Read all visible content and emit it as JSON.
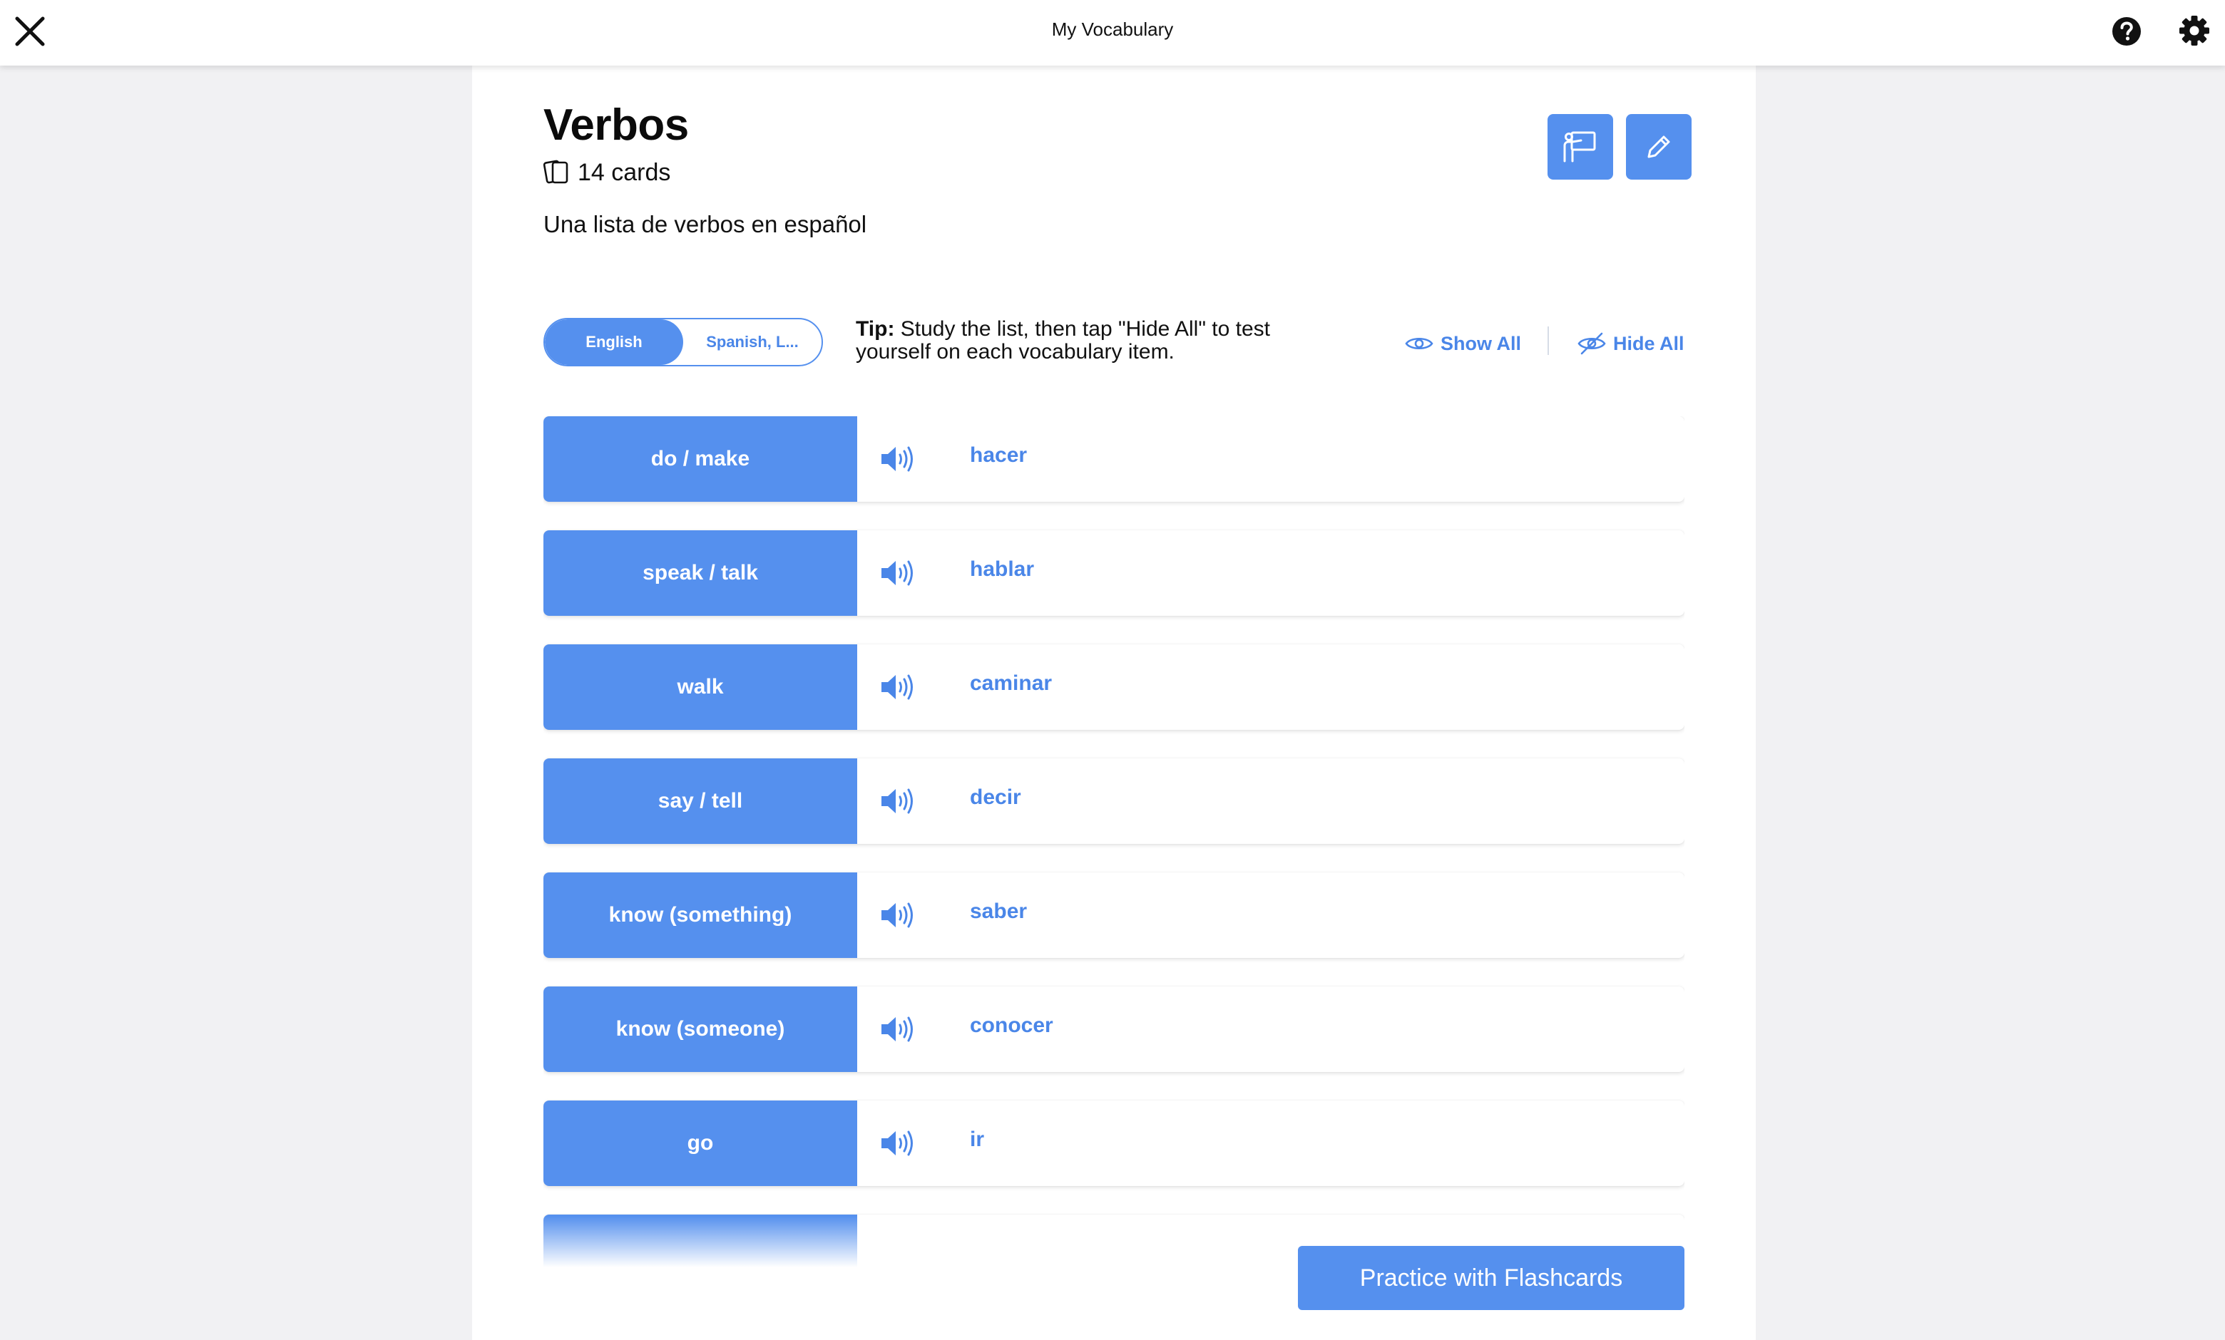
{
  "header": {
    "title": "My Vocabulary",
    "close_icon": "close-icon",
    "help_icon": "question-circle-icon",
    "settings_icon": "gear-icon"
  },
  "deck": {
    "title": "Verbos",
    "card_count": "14 cards",
    "description": "Una lista de verbos en español"
  },
  "language_toggle": {
    "options": [
      "English",
      "Spanish, L..."
    ],
    "selected": "English"
  },
  "tip": {
    "label": "Tip:",
    "text": " Study the list, then tap \"Hide All\" to test yourself on each vocabulary item."
  },
  "actions": {
    "show_all": "Show All",
    "hide_all": "Hide All",
    "practice": "Practice with Flashcards"
  },
  "vocab": [
    {
      "english": "do / make",
      "spanish": "hacer"
    },
    {
      "english": "speak / talk",
      "spanish": "hablar"
    },
    {
      "english": "walk",
      "spanish": "caminar"
    },
    {
      "english": "say / tell",
      "spanish": "decir"
    },
    {
      "english": "know (something)",
      "spanish": "saber"
    },
    {
      "english": "know (someone)",
      "spanish": "conocer"
    },
    {
      "english": "go",
      "spanish": "ir"
    }
  ],
  "colors": {
    "accent": "#5590ee",
    "link": "#4a86e8",
    "background": "#f1f1f3"
  }
}
